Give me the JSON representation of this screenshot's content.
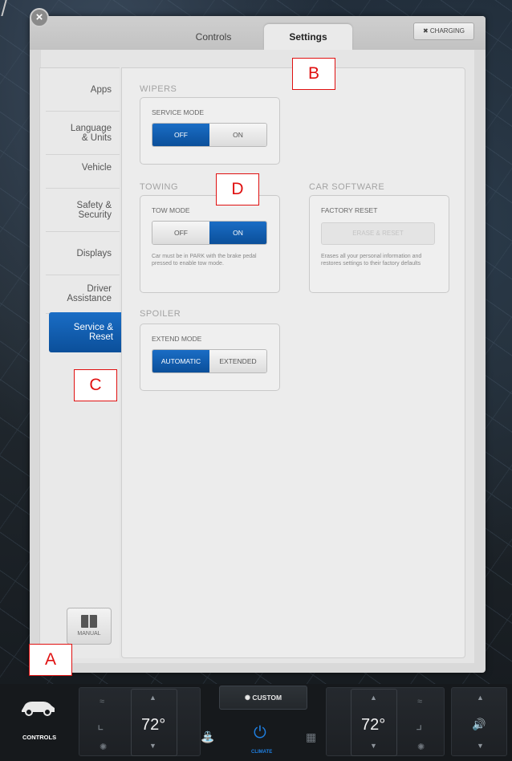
{
  "tabs": {
    "controls": "Controls",
    "settings": "Settings",
    "charging": "CHARGING",
    "charging_icon": "plug-icon",
    "close_icon": "close-icon"
  },
  "sidebar": {
    "items": [
      {
        "label": "Apps"
      },
      {
        "label": "Language\n& Units"
      },
      {
        "label": "Vehicle"
      },
      {
        "label": "Safety &\nSecurity"
      },
      {
        "label": "Displays"
      },
      {
        "label": "Driver\nAssistance"
      },
      {
        "label": "Service &\nReset",
        "selected": true
      }
    ],
    "manual": "MANUAL"
  },
  "wipers": {
    "title": "WIPERS",
    "label": "SERVICE MODE",
    "off": "OFF",
    "on": "ON",
    "selected": "OFF"
  },
  "towing": {
    "title": "TOWING",
    "label": "TOW MODE",
    "off": "OFF",
    "on": "ON",
    "selected": "ON",
    "note": "Car must be in PARK with the brake pedal pressed to enable tow mode."
  },
  "software": {
    "title": "CAR SOFTWARE",
    "label": "FACTORY RESET",
    "button": "ERASE & RESET",
    "note": "Erases all your personal information and restores settings to their factory defaults"
  },
  "spoiler": {
    "title": "SPOILER",
    "label": "EXTEND MODE",
    "automatic": "AUTOMATIC",
    "extended": "EXTENDED",
    "selected": "AUTOMATIC"
  },
  "annotations": {
    "a": "A",
    "b": "B",
    "c": "C",
    "d": "D"
  },
  "bottom": {
    "controls_label": "CONTROLS",
    "left_temp": "72°",
    "right_temp": "72°",
    "custom": "CUSTOM",
    "climate": "CLIMATE"
  },
  "colors": {
    "accent": "#0b4f9a",
    "annotation": "#e01010"
  }
}
